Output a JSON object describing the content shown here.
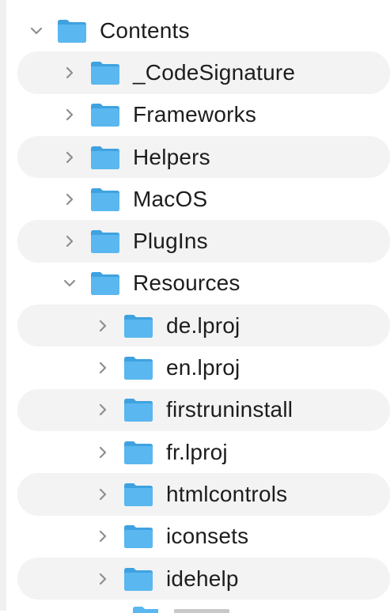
{
  "tree": {
    "root": {
      "label": "Contents",
      "expanded": true
    },
    "items": [
      {
        "label": "_CodeSignature",
        "expanded": false
      },
      {
        "label": "Frameworks",
        "expanded": false
      },
      {
        "label": "Helpers",
        "expanded": false
      },
      {
        "label": "MacOS",
        "expanded": false
      },
      {
        "label": "PlugIns",
        "expanded": false
      },
      {
        "label": "Resources",
        "expanded": true
      }
    ],
    "resources": [
      {
        "label": "de.lproj",
        "expanded": false
      },
      {
        "label": "en.lproj",
        "expanded": false
      },
      {
        "label": "firstruninstall",
        "expanded": false
      },
      {
        "label": "fr.lproj",
        "expanded": false
      },
      {
        "label": "htmlcontrols",
        "expanded": false
      },
      {
        "label": "iconsets",
        "expanded": false
      },
      {
        "label": "idehelp",
        "expanded": false
      }
    ]
  },
  "colors": {
    "folder_front": "#5ab7ef",
    "folder_back": "#3fa2e0",
    "band": "#f3f3f3",
    "text": "#1d1d1f",
    "chevron": "#8e8e93"
  }
}
